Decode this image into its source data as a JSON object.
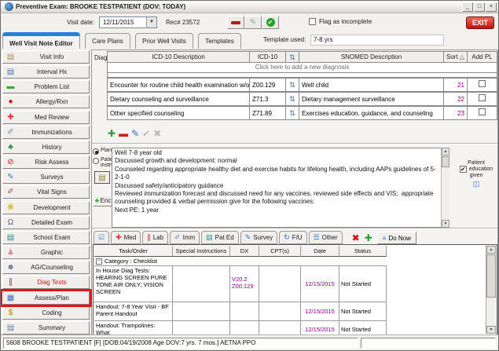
{
  "window": {
    "title": "Preventive Exam: BROOKE TESTPATIENT (DOV: TODAY)"
  },
  "toolbar": {
    "visit_date_label": "Visit date:",
    "visit_date_value": "12/11/2015",
    "rec_label": "Rec# 23572",
    "flag_label": "Flag as incomplete",
    "exit_label": "EXIT"
  },
  "tabs": [
    {
      "label": "Well Visit Note Editor"
    },
    {
      "label": "Care Plans"
    },
    {
      "label": "Prior Well Visits"
    },
    {
      "label": "Templates"
    }
  ],
  "template_used": {
    "label": "Template used:",
    "value": "7-8 yrs"
  },
  "sidebar": {
    "items": [
      {
        "label": "Visit Info"
      },
      {
        "label": "Interval Hx"
      },
      {
        "label": "Problem List"
      },
      {
        "label": "Allergy/Rxn"
      },
      {
        "label": "Med Review"
      },
      {
        "label": "Immunizations"
      },
      {
        "label": "History"
      },
      {
        "label": "Risk Assess"
      },
      {
        "label": "Surveys"
      },
      {
        "label": "Vital Signs"
      },
      {
        "label": "Development"
      },
      {
        "label": "Detailed Exam"
      },
      {
        "label": "School Exam"
      },
      {
        "label": "Graphic"
      },
      {
        "label": "AG/Counseling"
      },
      {
        "label": "Diag Tests"
      },
      {
        "label": "Assess/Plan"
      },
      {
        "label": "Coding"
      },
      {
        "label": "Summary"
      }
    ]
  },
  "diagnoses": {
    "label": "Diagnoses:",
    "headers": {
      "icd10_desc": "ICD-10 Description",
      "icd10": "ICD-10",
      "snomed": "SNOMED Description",
      "sort": "Sort",
      "add_pl": "Add PL"
    },
    "add_row_text": "Click here to add a new diagnosis",
    "rows": [
      {
        "icd10_desc": "Encounter for routine child health examination w/o",
        "icd10": "Z00.129",
        "snomed": "Well child",
        "sort": "21"
      },
      {
        "icd10_desc": "Dietary counseling and surveillance",
        "icd10": "Z71.3",
        "snomed": "Dietary management surveillance",
        "sort": "22"
      },
      {
        "icd10_desc": "Other specified counseling",
        "icd10": "Z71.89",
        "snomed": "Exercises education, guidance, and counseling",
        "sort": "23"
      }
    ]
  },
  "plan": {
    "plan_label": "Plan:",
    "patient_instruct_label": "Patient instruct:",
    "enc_label": "Enc",
    "text": "Well 7-8 year old\nDiscussed growth and development: normal\nCounseled regarding appropriate healthy diet and exercise habits for lifelong health, including AAPs guidelines of 5-2-1-0\nDiscussed safety/anticipatory guidance\nReviewed immunization forecast and discussed need for any vaccines, reviewed side effects and VIS;  appropriate counseling provided & verbal permission give for the following vaccines:\nNext PE: 1 year",
    "patient_education_line1": "Patient",
    "patient_education_line2": "education",
    "patient_education_line3": "given"
  },
  "orders": {
    "tabs": [
      {
        "label": "Med"
      },
      {
        "label": "Lab"
      },
      {
        "label": "Imm"
      },
      {
        "label": "Pat Ed"
      },
      {
        "label": "Survey"
      },
      {
        "label": "F/U"
      },
      {
        "label": "Other"
      }
    ],
    "do_now_label": "Do Now",
    "headers": {
      "task": "Task/Order",
      "instructions": "Special Instructions",
      "dx": "DX",
      "cpt": "CPT(s)",
      "date": "Date",
      "status": "Status"
    },
    "category_row": "Category : Checklist",
    "rows": [
      {
        "task": "In House Diag Tests:\nHEARING SCREEN PURE\nTONE AIR ONLY; VISION\nSCREEN",
        "instructions": "",
        "dx": "V20.2\nZ00.129",
        "cpt": "",
        "date": "12/15/2015",
        "status": "Not Started"
      },
      {
        "task": "Handout: 7-8 Year Visit - BF\nParent Handout",
        "instructions": "",
        "dx": "",
        "cpt": "",
        "date": "12/15/2015",
        "status": "Not Started"
      },
      {
        "task": "Handout: Trampolines: What\nYou Need to Know",
        "instructions": "",
        "dx": "",
        "cpt": "",
        "date": "12/15/2015",
        "status": "Not Started"
      }
    ]
  },
  "status_bar": {
    "text": "5608 BROOKE TESTPATIENT [F] [DOB:04/19/2008  Age DOV:7 yrs. 7 mos.] AETNA PPO"
  },
  "colors": {
    "accent_blue": "#2a7fd6",
    "exit_red": "#c01212",
    "annotation_red": "#ee1111",
    "purple_values": "#8b008b",
    "diag_tests_red": "#e01010"
  },
  "icons": {
    "win_min": {
      "glyph": "_",
      "color": "#222"
    },
    "win_max": {
      "glyph": "□",
      "color": "#222"
    },
    "win_close": {
      "glyph": "×",
      "color": "#222"
    },
    "dropdown_arrow": {
      "glyph": "▼",
      "color": "#333"
    },
    "checkmark": {
      "glyph": "✔",
      "color": "#111"
    },
    "pencil_gray": {
      "glyph": "✎",
      "color": "#9a9a9a"
    },
    "check_white": {
      "glyph": "✔",
      "color": "#fff"
    },
    "visit_info": {
      "glyph": "▤",
      "color": "#b08950"
    },
    "interval_hx": {
      "glyph": "▤",
      "color": "#4a72b8"
    },
    "problem_list": {
      "glyph": "▬",
      "color": "#3f9e3f"
    },
    "allergy": {
      "glyph": "●",
      "color": "#cc1111"
    },
    "med_review": {
      "glyph": "✚",
      "color": "#cc3333"
    },
    "immunizations": {
      "glyph": "✐",
      "color": "#7a8fb5"
    },
    "history": {
      "glyph": "♣",
      "color": "#2e8b2e"
    },
    "risk_assess": {
      "glyph": "⊘",
      "color": "#cc1111"
    },
    "surveys": {
      "glyph": "✎",
      "color": "#3a6fc0"
    },
    "vital_signs": {
      "glyph": "✐",
      "color": "#b05050"
    },
    "development": {
      "glyph": "❋",
      "color": "#d6a51c"
    },
    "detailed_exam": {
      "glyph": "Ω",
      "color": "#555577"
    },
    "school_exam": {
      "glyph": "▤",
      "color": "#2e8b8b"
    },
    "graphic": {
      "glyph": "♟",
      "color": "#d98ca0"
    },
    "ag_counseling": {
      "glyph": "☻",
      "color": "#6a7a9a"
    },
    "diag_tests": {
      "glyph": "∥",
      "color": "#cc1111"
    },
    "assess_plan": {
      "glyph": "▦",
      "color": "#3a6fc0"
    },
    "coding": {
      "glyph": "$",
      "color": "#b8860b"
    },
    "summary": {
      "glyph": "▤",
      "color": "#6a7a9a"
    },
    "sync": {
      "glyph": "⇅",
      "color": "#2b6cb8"
    },
    "sort_asc": {
      "glyph": "△",
      "color": "#555"
    },
    "add_plus": {
      "glyph": "✚",
      "color": "#2ca02c"
    },
    "remove_minus": {
      "glyph": "▬",
      "color": "#cc1f1f"
    },
    "edit_pencil": {
      "glyph": "✎",
      "color": "#3a6fc0"
    },
    "ok_disabled": {
      "glyph": "✔",
      "color": "#bbb"
    },
    "cancel_disabled": {
      "glyph": "✖",
      "color": "#bbb"
    },
    "book": {
      "glyph": "▤",
      "color": "#8a8a2a"
    },
    "enc_plus": {
      "glyph": "✚",
      "color": "#2ca02c"
    },
    "patient_education_book": {
      "glyph": "◫",
      "color": "#2b6cb8"
    },
    "orders_checklist": {
      "glyph": "☑",
      "color": "#3a6fc0"
    },
    "med_tab": {
      "glyph": "✚",
      "color": "#cc3333"
    },
    "lab_tab": {
      "glyph": "∥",
      "color": "#cc1111"
    },
    "imm_tab": {
      "glyph": "✐",
      "color": "#7a8fb5"
    },
    "pat_ed_tab": {
      "glyph": "▤",
      "color": "#2e8b8b"
    },
    "survey_tab": {
      "glyph": "✎",
      "color": "#3a6fc0"
    },
    "fu_tab": {
      "glyph": "↻",
      "color": "#3a6fc0"
    },
    "other_tab": {
      "glyph": "☰",
      "color": "#3a6fc0"
    },
    "delete_x": {
      "glyph": "✖",
      "color": "#cc1111"
    },
    "do_now": {
      "glyph": "≡",
      "color": "#3a6fc0"
    },
    "scroll_up": {
      "glyph": "▲",
      "color": "#444"
    },
    "scroll_down": {
      "glyph": "▼",
      "color": "#444"
    },
    "collapse_minus": {
      "glyph": "−",
      "color": "#333"
    }
  }
}
